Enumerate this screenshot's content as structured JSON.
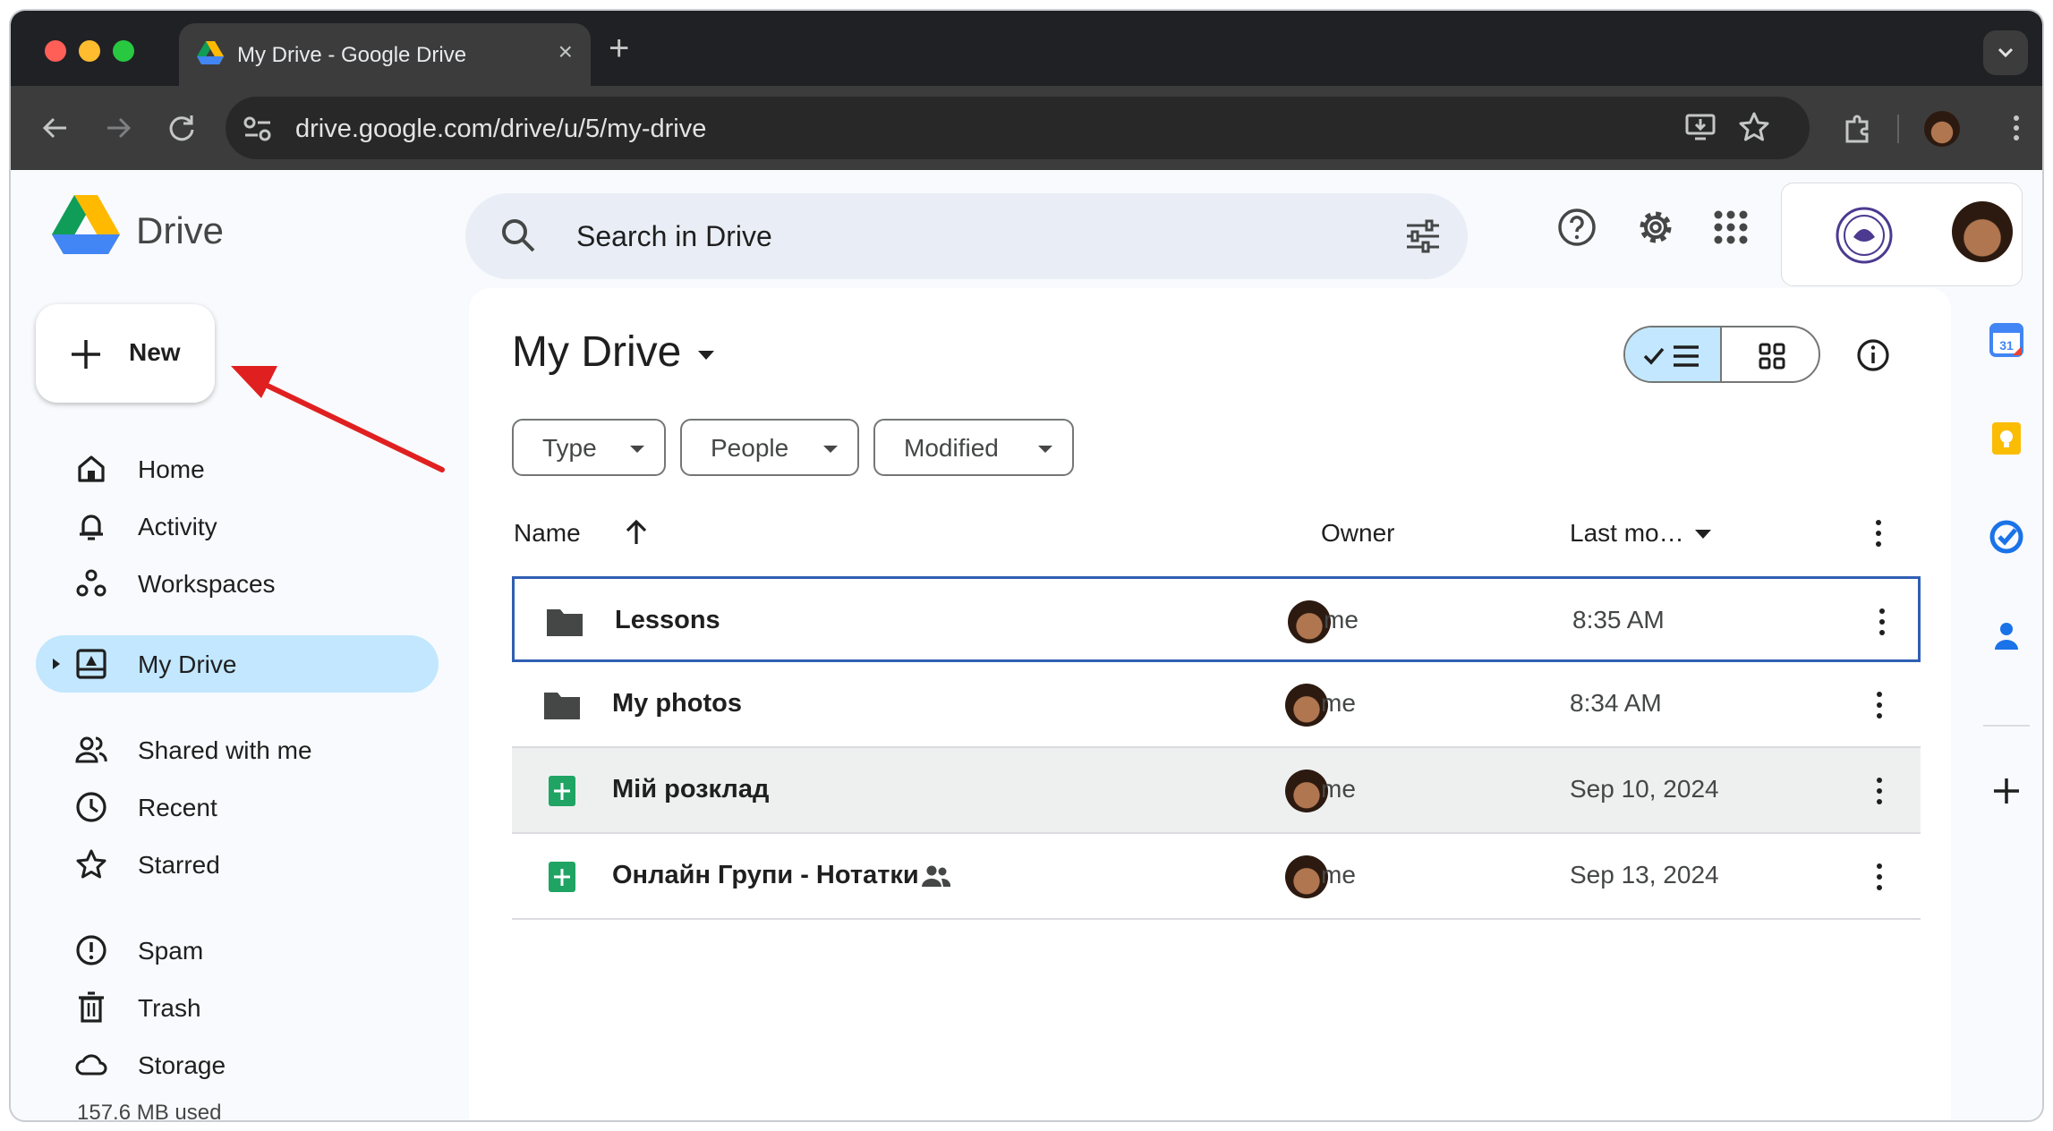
{
  "browser": {
    "tab_title": "My Drive - Google Drive",
    "tab_close": "×",
    "new_tab": "+",
    "url": "drive.google.com/drive/u/5/my-drive"
  },
  "app": {
    "logo_text": "Drive",
    "search_placeholder": "Search in Drive"
  },
  "sidebar": {
    "new_label": "New",
    "items": [
      {
        "label": "Home"
      },
      {
        "label": "Activity"
      },
      {
        "label": "Workspaces"
      },
      {
        "label": "My Drive"
      },
      {
        "label": "Shared with me"
      },
      {
        "label": "Recent"
      },
      {
        "label": "Starred"
      },
      {
        "label": "Spam"
      },
      {
        "label": "Trash"
      },
      {
        "label": "Storage"
      }
    ],
    "storage_used": "157.6 MB used"
  },
  "main": {
    "title": "My Drive",
    "filters": [
      {
        "label": "Type"
      },
      {
        "label": "People"
      },
      {
        "label": "Modified"
      }
    ],
    "columns": {
      "name": "Name",
      "owner": "Owner",
      "modified": "Last mo…"
    },
    "rows": [
      {
        "name": "Lessons",
        "type": "folder",
        "owner": "me",
        "modified": "8:35 AM"
      },
      {
        "name": "My photos",
        "type": "folder",
        "owner": "me",
        "modified": "8:34 AM"
      },
      {
        "name": "Мій розклад",
        "type": "sheet",
        "owner": "me",
        "modified": "Sep 10, 2024"
      },
      {
        "name": "Онлайн Групи - Нотатки",
        "type": "sheet",
        "owner": "me",
        "modified": "Sep 13, 2024",
        "shared": true
      }
    ]
  },
  "colors": {
    "accent": "#c2e7ff",
    "selection_border": "#2f5fb3",
    "annotation_arrow": "#e02020"
  }
}
